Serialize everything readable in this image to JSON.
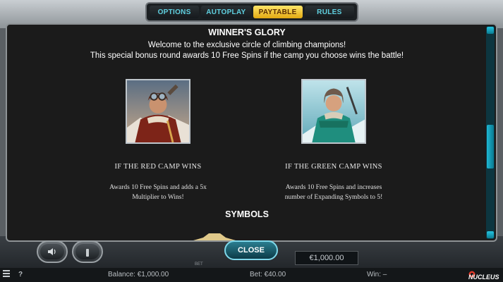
{
  "tabs": [
    {
      "label": "OPTIONS",
      "active": false
    },
    {
      "label": "AUTOPLAY",
      "active": false
    },
    {
      "label": "PAYTABLE",
      "active": true
    },
    {
      "label": "RULES",
      "active": false
    }
  ],
  "content": {
    "title": "WINNER'S GLORY",
    "intro_line1": "Welcome to the exclusive circle of climbing champions!",
    "intro_line2": "This special bonus round awards 10 Free Spins if the camp you choose wins the battle!",
    "red_camp": {
      "heading": "IF THE RED CAMP WINS",
      "desc_line1": "Awards 10 Free Spins and adds a 5x",
      "desc_line2": "Multiplier to Wins!"
    },
    "green_camp": {
      "heading": "IF THE GREEN CAMP WINS",
      "desc_line1": "Awards 10 Free Spins and increases",
      "desc_line2": "number of Expanding Symbols to 5!"
    },
    "symbols_title": "SYMBOLS"
  },
  "controls": {
    "close_label": "CLOSE",
    "bet_display": "€1,000.00",
    "bet_label": "BET",
    "sound_icon": "speaker-icon",
    "info_icon": "info-icon"
  },
  "status_bar": {
    "balance": "Balance: €1,000.00",
    "bet": "Bet: €40.00",
    "win": "Win: –",
    "brand": "NUCLEUS"
  },
  "colors": {
    "accent": "#5fd0e0",
    "active_tab": "#f3c52c",
    "panel_bg": "#1b1b1b",
    "scrollbar": "#1fb7d4"
  }
}
